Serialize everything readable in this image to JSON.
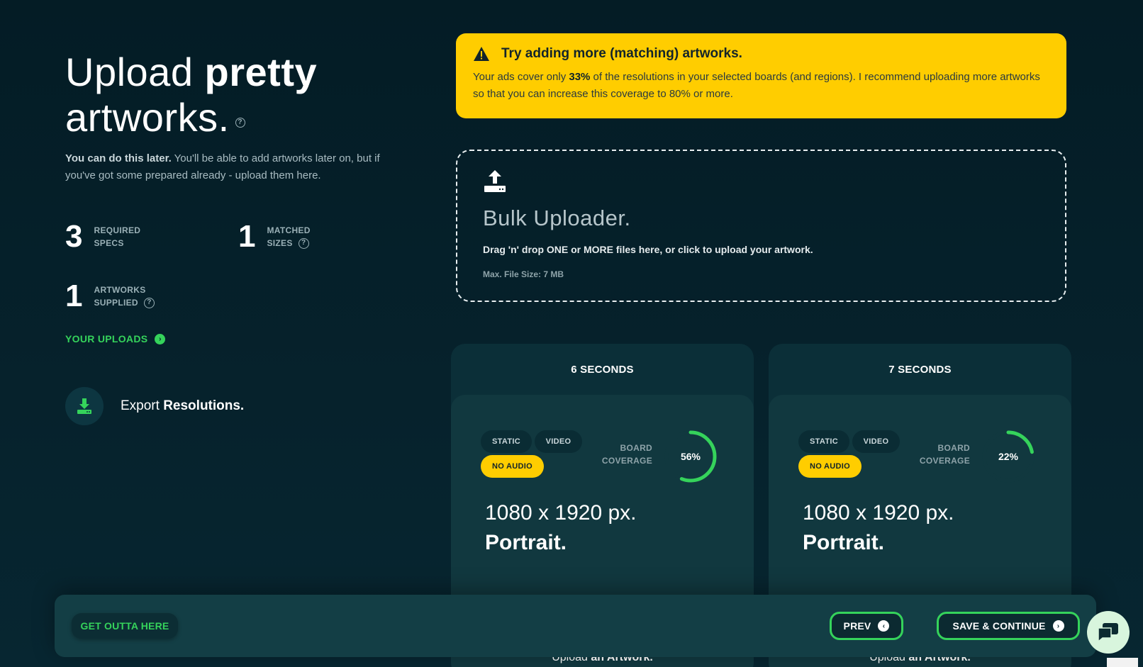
{
  "heading": {
    "part1": "Upload ",
    "part2": "pretty",
    "part3": "artworks."
  },
  "subtitle": {
    "bold": "You can do this later.",
    "rest": " You'll be able to add artworks later on, but if you've got some prepared already - upload them here."
  },
  "stats": [
    {
      "num": "3",
      "line1": "REQUIRED",
      "line2": "SPECS"
    },
    {
      "num": "1",
      "line1": "MATCHED",
      "line2": "SIZES"
    },
    {
      "num": "1",
      "line1": "ARTWORKS",
      "line2": "SUPPLIED"
    }
  ],
  "your_uploads": "YOUR UPLOADS",
  "export": {
    "normal": "Export ",
    "bold": "Resolutions."
  },
  "alert": {
    "title": "Try adding more (matching) artworks.",
    "pre": "Your ads cover only ",
    "pct": "33%",
    "post": " of the resolutions in your selected boards (and regions). I recommend uploading more artworks so that you can increase this coverage to 80% or more."
  },
  "uploader": {
    "title": "Bulk Uploader.",
    "line1": "Drag 'n' drop ONE or MORE files here, or click to upload your artwork.",
    "line2": "Max. File Size: 7 MB"
  },
  "cards": [
    {
      "title": "6 SECONDS",
      "tags": [
        "STATIC",
        "VIDEO",
        "NO AUDIO"
      ],
      "coverage_label1": "BOARD",
      "coverage_label2": "COVERAGE",
      "coverage_text": "56%",
      "coverage": 0.56,
      "resolution": "1080 x 1920 px.",
      "orientation": "Portrait.",
      "upload_normal": "Upload ",
      "upload_bold": "an Artwork."
    },
    {
      "title": "7 SECONDS",
      "tags": [
        "STATIC",
        "VIDEO",
        "NO AUDIO"
      ],
      "coverage_label1": "BOARD",
      "coverage_label2": "COVERAGE",
      "coverage_text": "22%",
      "coverage": 0.22,
      "resolution": "1080 x 1920 px.",
      "orientation": "Portrait.",
      "upload_normal": "Upload ",
      "upload_bold": "an Artwork."
    }
  ],
  "footer": {
    "exit": "GET OUTTA HERE",
    "prev": "PREV",
    "save": "SAVE & CONTINUE"
  },
  "colors": {
    "accent_green": "#35d35b",
    "alert_yellow": "#ffcd00",
    "background": "#062029"
  }
}
